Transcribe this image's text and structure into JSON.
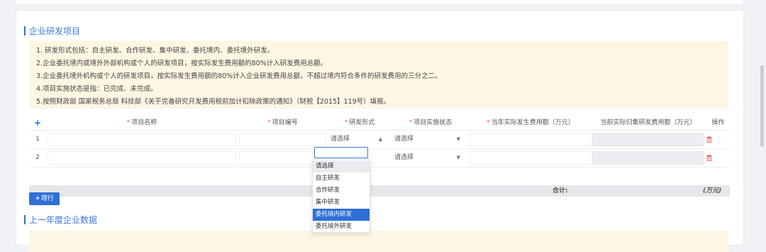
{
  "section1": {
    "title": "企业研发项目"
  },
  "notice": {
    "lines": [
      "1. 研发形式包括：自主研发、合作研发、集中研发、委托境内、委托境外研发。",
      "2.企业委托境内或境外外部机构或个人的研发项目，按实际发生费用额的80%计入研发费用总额。",
      "3.企业委托境外机构或个人的研发项目，按实际发生费用额的80%计入企业研发费用总额，不超过境内符合条件的研发费用的三分之二。",
      "4.项目实施状态是指：已完成、未完成。",
      "5.按照财政部 国家税务总局 科技部《关于完善研究开发费用税前加计扣除政策的通知》（财税【2015】119号）填报。"
    ]
  },
  "table": {
    "columns": [
      {
        "label": "项目名称",
        "required": "*"
      },
      {
        "label": "项目编号",
        "required": "*"
      },
      {
        "label": "研发形式",
        "required": "*"
      },
      {
        "label": "项目实施状态",
        "required": "*"
      },
      {
        "label": "当年实际发生费用额（万元）",
        "required": "*"
      },
      {
        "label": "当前实际归集研发费用额（万元）",
        "required": ""
      },
      {
        "label": "操作",
        "required": ""
      }
    ],
    "rows": [
      {
        "index": "1",
        "form_value": "请选择",
        "status_value": "请选择"
      },
      {
        "index": "2",
        "form_value": "",
        "status_value": "请选择"
      }
    ],
    "footer": {
      "total_label": "合计:",
      "unit": "(万元)"
    }
  },
  "add_button": {
    "label": "增行"
  },
  "dropdown": {
    "options": [
      "请选择",
      "自主研发",
      "合作研发",
      "集中研发",
      "委托境内研发",
      "委托境外研发"
    ],
    "hovered": "请选择",
    "selected": "委托境内研发"
  },
  "section2": {
    "title": "上一年度企业数据"
  },
  "colors": {
    "accent": "#2f6fd6",
    "required": "#f25a5a",
    "notice_bg": "#fdf6e3",
    "delete": "#f25a5a"
  },
  "icons": {
    "add_row": "plus-icon",
    "delete": "trash-icon",
    "select_arrow": "caret-icon"
  }
}
